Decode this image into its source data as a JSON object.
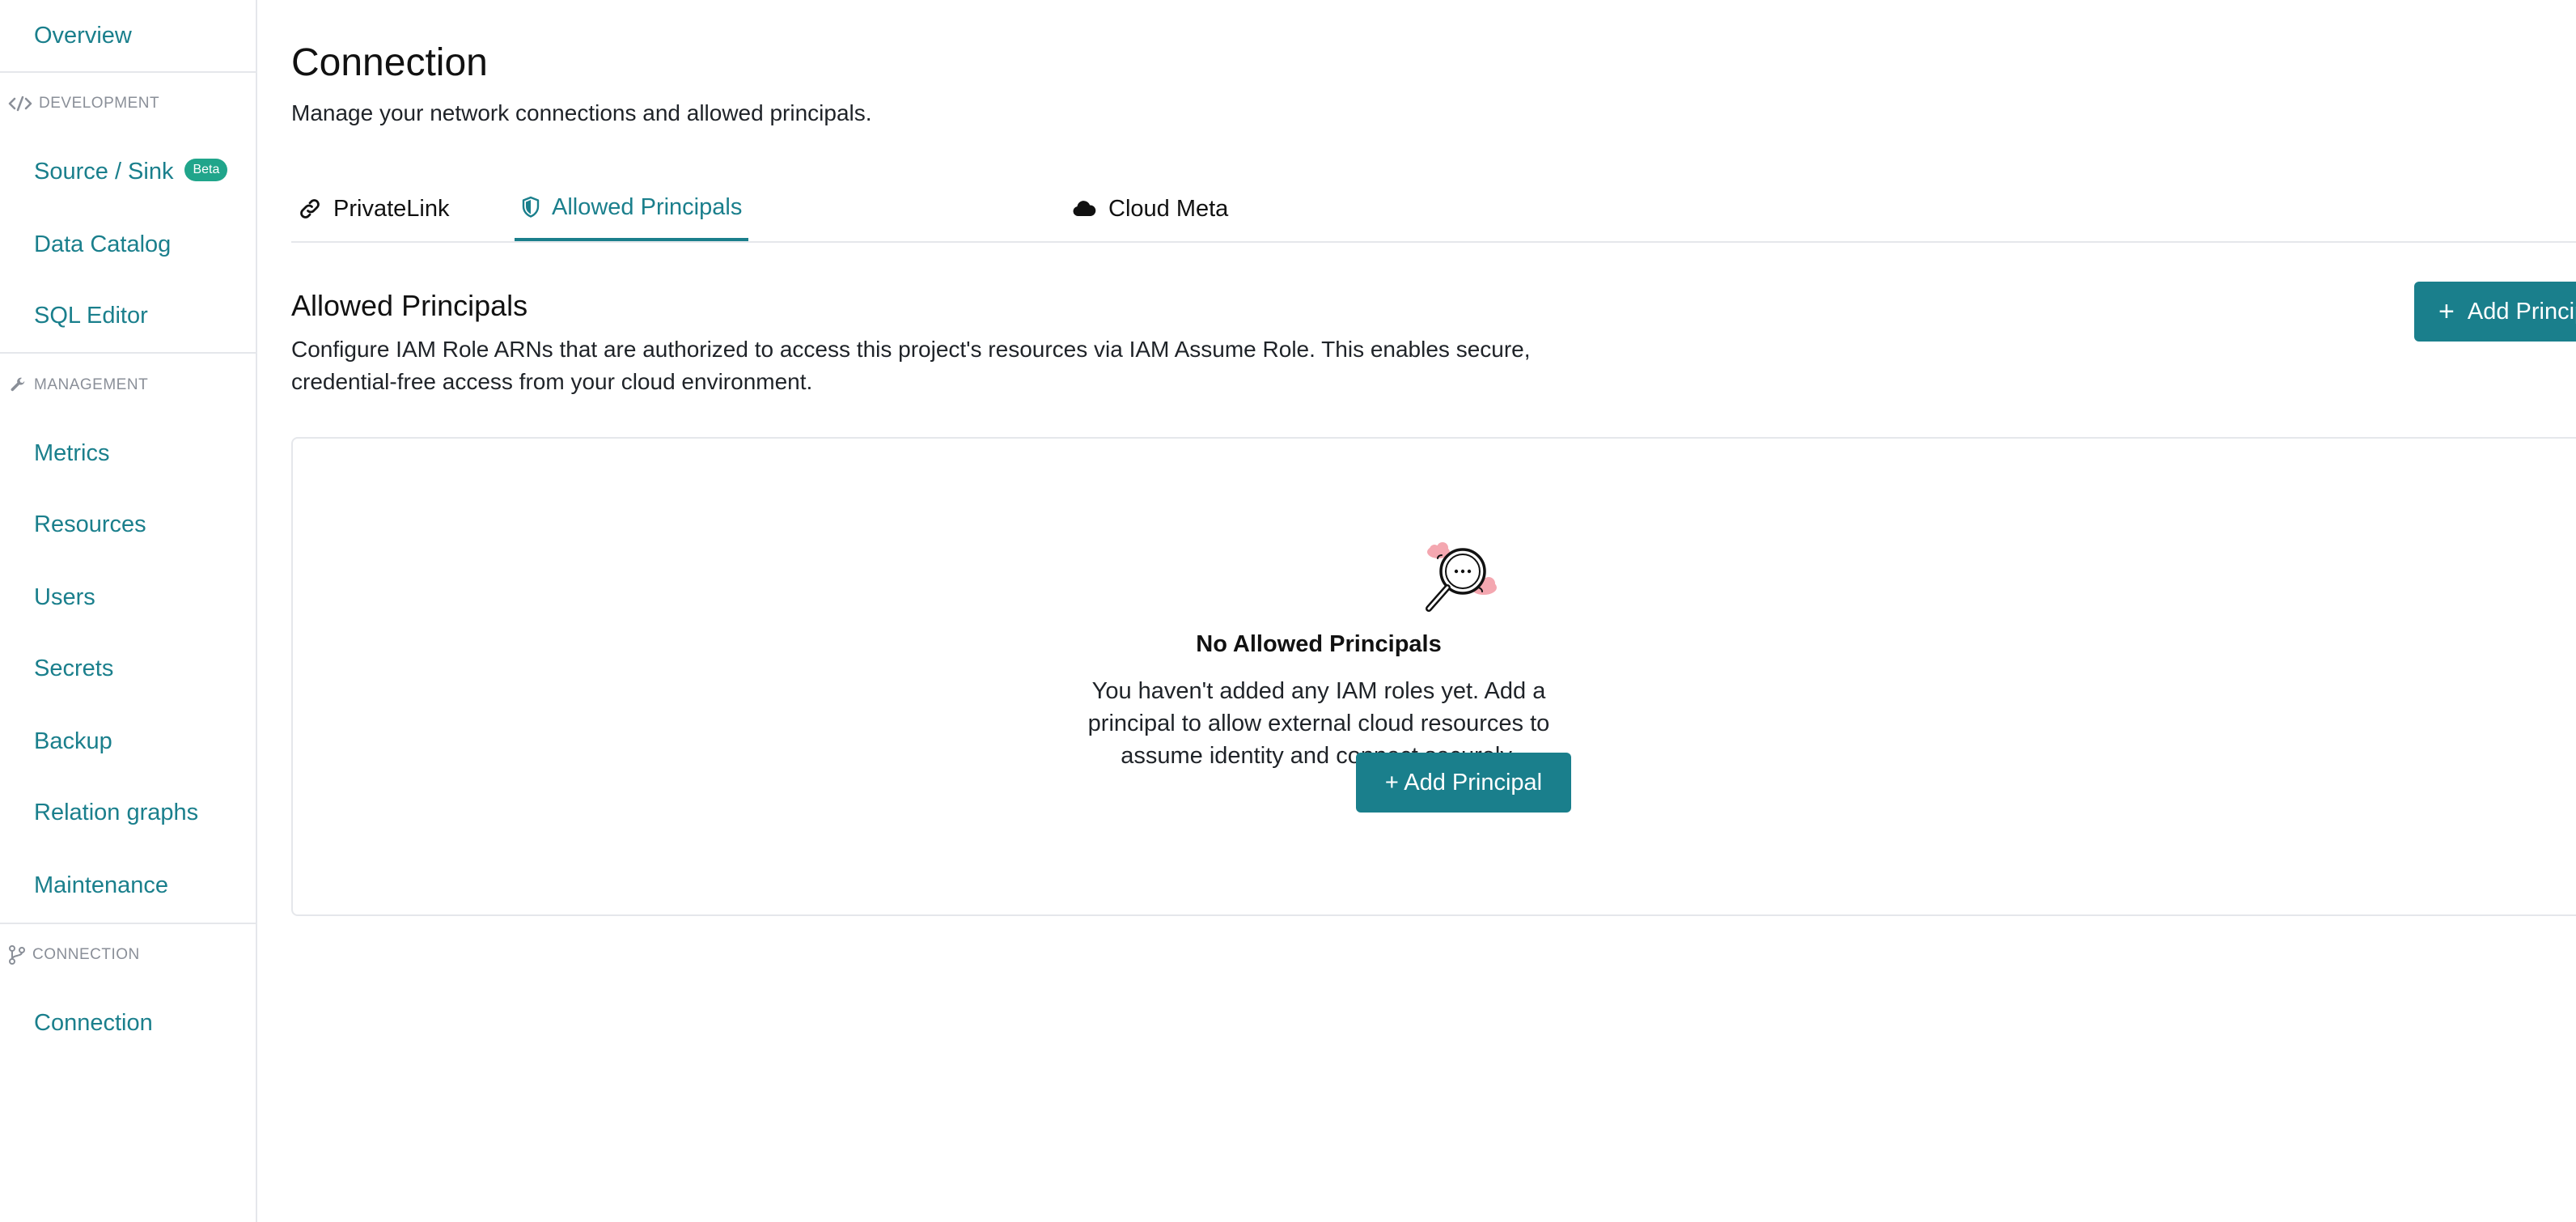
{
  "sidebar": {
    "overview": "Overview",
    "sections": {
      "development": "DEVELOPMENT",
      "management": "MANAGEMENT",
      "connection": "CONNECTION"
    },
    "items": {
      "source_sink": "Source / Sink",
      "source_sink_badge": "Beta",
      "data_catalog": "Data Catalog",
      "sql_editor": "SQL Editor",
      "metrics": "Metrics",
      "resources": "Resources",
      "users": "Users",
      "secrets": "Secrets",
      "backup": "Backup",
      "relation_graphs": "Relation graphs",
      "maintenance": "Maintenance",
      "connection": "Connection"
    },
    "icons": {
      "development": "code-icon",
      "management": "wrench-icon",
      "connection": "git-branch-icon"
    }
  },
  "page": {
    "title": "Connection",
    "subtitle": "Manage your network connections and allowed principals."
  },
  "tabs": [
    {
      "label": "PrivateLink",
      "icon": "link-icon",
      "active": false
    },
    {
      "label": "Allowed Principals",
      "icon": "shield-icon",
      "active": true
    },
    {
      "label": "Cloud Meta",
      "icon": "cloud-icon",
      "active": false
    }
  ],
  "section": {
    "title": "Allowed Principals",
    "description": "Configure IAM Role ARNs that are authorized to access this project's resources via IAM Assume Role. This enables secure, credential-free access from your cloud environment.",
    "add_button": "Add Principal"
  },
  "empty_state": {
    "title": "No Allowed Principals",
    "description": "You haven't added any IAM roles yet. Add a principal to allow external cloud resources to assume identity and connect securely.",
    "button": "+ Add Principal",
    "illustration": "magnifier-search-icon"
  },
  "colors": {
    "accent": "#1a7f8c",
    "badge": "#20a58b",
    "border": "#e5e7eb",
    "muted": "#8a8f98"
  }
}
